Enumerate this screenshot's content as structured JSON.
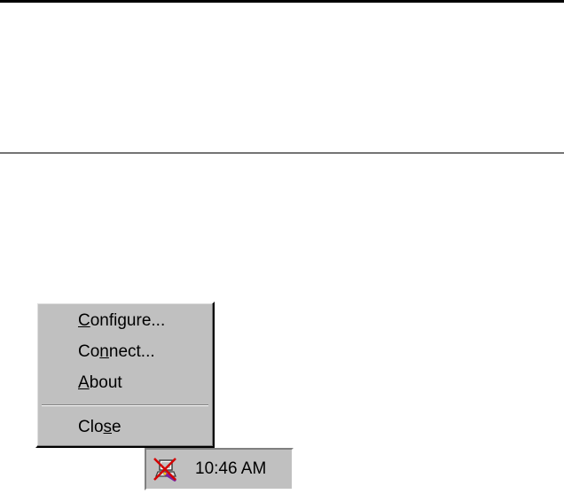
{
  "context_menu": {
    "items": [
      {
        "pre": "",
        "accel": "C",
        "post": "onfigure..."
      },
      {
        "pre": "Co",
        "accel": "n",
        "post": "nect..."
      },
      {
        "pre": "",
        "accel": "A",
        "post": "bout"
      },
      {
        "pre": "Clo",
        "accel": "s",
        "post": "e"
      }
    ]
  },
  "tray": {
    "icon": "disconnected-network-icon",
    "clock": "10:46 AM"
  },
  "colors": {
    "face": "#c0c0c0",
    "shadow": "#808080",
    "highlight": "#ffffff",
    "icon_red": "#d40000",
    "icon_purple": "#7a1fa2"
  }
}
